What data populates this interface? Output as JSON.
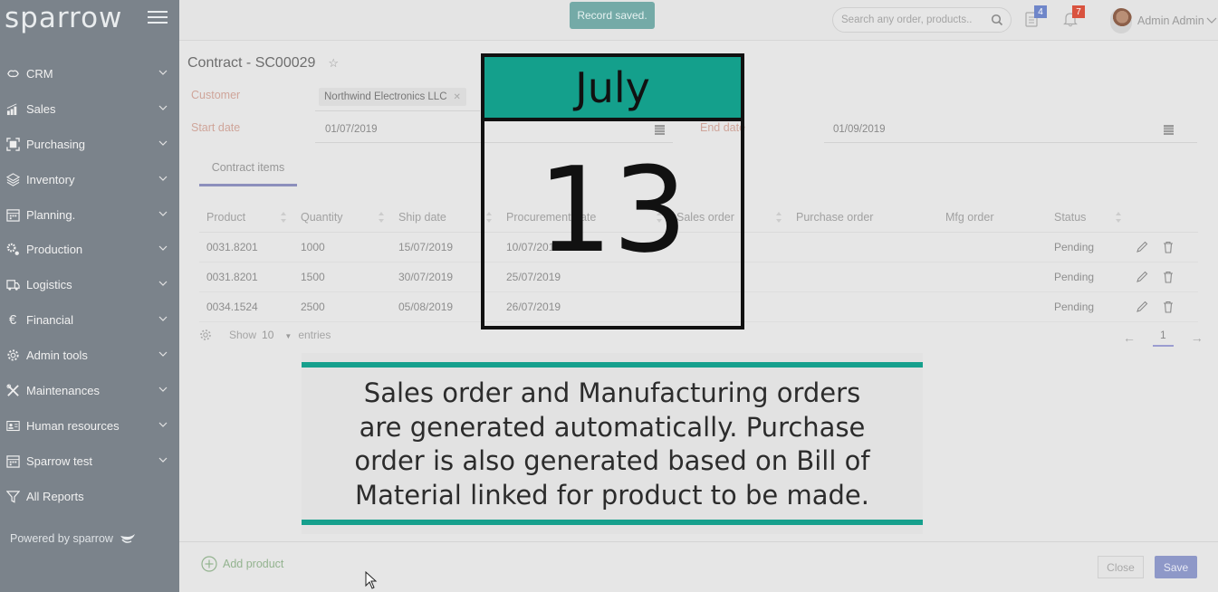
{
  "sidebar": {
    "logo": "sparrow",
    "items": [
      {
        "label": "CRM",
        "icon": "handshake-icon"
      },
      {
        "label": "Sales",
        "icon": "bar-chart-icon"
      },
      {
        "label": "Purchasing",
        "icon": "scan-box-icon"
      },
      {
        "label": "Inventory",
        "icon": "stack-icon"
      },
      {
        "label": "Planning.",
        "icon": "calendar-icon"
      },
      {
        "label": "Production",
        "icon": "gears-icon"
      },
      {
        "label": "Logistics",
        "icon": "truck-icon"
      },
      {
        "label": "Financial",
        "icon": "euro-icon"
      },
      {
        "label": "Admin tools",
        "icon": "gear-icon"
      },
      {
        "label": "Maintenances",
        "icon": "tools-icon"
      },
      {
        "label": "Human resources",
        "icon": "id-card-icon"
      },
      {
        "label": "Sparrow test",
        "icon": "calendar-icon"
      },
      {
        "label": "All Reports",
        "icon": "filter-icon"
      }
    ],
    "powered_by": "Powered by sparrow"
  },
  "topbar": {
    "toast": "Record saved.",
    "search_placeholder": "Search any order, products..",
    "tasks_badge": "4",
    "notifications_badge": "7",
    "user_name": "Admin Admin",
    "colors": {
      "tasks_badge": "#6f86c9",
      "notifications_badge": "#d9533f",
      "toast": "#74aaa7"
    }
  },
  "form": {
    "title": "Contract - SC00029",
    "customer_label": "Customer",
    "customer_value": "Northwind Electronics LLC",
    "start_date_label": "Start date",
    "start_date_value": "01/07/2019",
    "end_date_label": "End date",
    "end_date_value": "01/09/2019",
    "tab": "Contract items"
  },
  "table": {
    "columns": [
      "Product",
      "Quantity",
      "Ship date",
      "Procurement date",
      "Sales order",
      "Purchase order",
      "Mfg order",
      "Status"
    ],
    "rows": [
      {
        "product": "0031.8201",
        "quantity": "1000",
        "ship_date": "15/07/2019",
        "procurement_date": "10/07/2019",
        "sales_order": "",
        "purchase_order": "",
        "mfg_order": "",
        "status": "Pending"
      },
      {
        "product": "0031.8201",
        "quantity": "1500",
        "ship_date": "30/07/2019",
        "procurement_date": "25/07/2019",
        "sales_order": "",
        "purchase_order": "",
        "mfg_order": "",
        "status": "Pending"
      },
      {
        "product": "0034.1524",
        "quantity": "2500",
        "ship_date": "05/08/2019",
        "procurement_date": "26/07/2019",
        "sales_order": "",
        "purchase_order": "",
        "mfg_order": "",
        "status": "Pending"
      }
    ],
    "show_label": "Show",
    "page_size": "10",
    "entries_label": "entries",
    "current_page": "1"
  },
  "footer": {
    "add_product": "Add product",
    "close": "Close",
    "save": "Save"
  },
  "overlay": {
    "calendar_month": "July",
    "calendar_day": "13",
    "caption": "Sales order and Manufacturing orders are generated automatically. Purchase order is also generated based on Bill of Material linked for product to be made.",
    "caption_lines": [
      "Sales order and Manufacturing orders",
      "are generated automatically. Purchase",
      "order is also generated based on Bill of",
      "Material linked for product to be made."
    ],
    "accent_color": "#14a08c"
  }
}
